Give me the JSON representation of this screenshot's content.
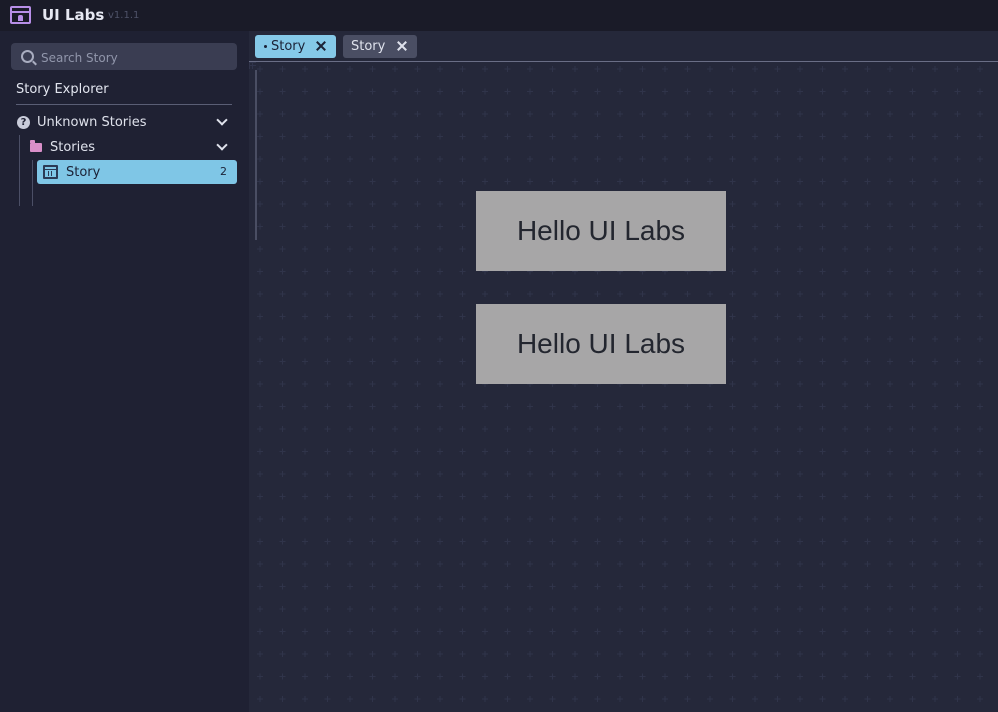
{
  "app": {
    "title": "UI Labs",
    "version": "v1.1.1"
  },
  "sidebar": {
    "search": {
      "placeholder": "Search Story",
      "value": ""
    },
    "explorer_title": "Story Explorer",
    "tree": {
      "unknown_label": "Unknown Stories",
      "stories_label": "Stories",
      "story_label": "Story",
      "story_count": "2"
    }
  },
  "tabs": [
    {
      "label": "Story",
      "active": true
    },
    {
      "label": "Story",
      "active": false
    }
  ],
  "canvas": {
    "boxes": [
      {
        "text": "Hello UI Labs"
      },
      {
        "text": "Hello UI Labs"
      }
    ]
  },
  "colors": {
    "accent": "#7fc6e6",
    "background": "#25283a",
    "sidebar": "#1f2133",
    "box": "#a7a6a7"
  }
}
